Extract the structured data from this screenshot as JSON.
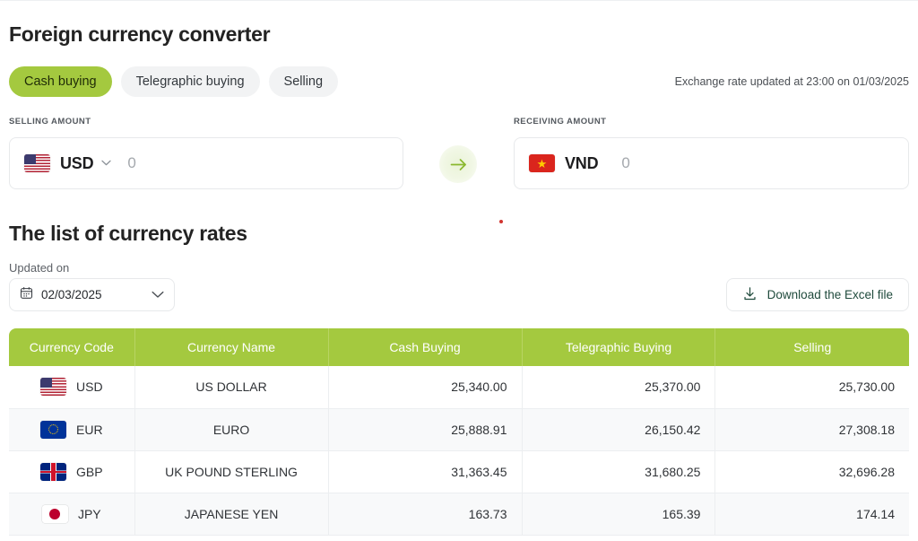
{
  "converter": {
    "title": "Foreign currency converter",
    "tabs": [
      {
        "label": "Cash buying",
        "active": true
      },
      {
        "label": "Telegraphic buying",
        "active": false
      },
      {
        "label": "Selling",
        "active": false
      }
    ],
    "rate_updated_text": "Exchange rate updated at 23:00 on 01/03/2025",
    "selling": {
      "label": "SELLING AMOUNT",
      "currency_code": "USD",
      "flag_icon": "us-flag-icon",
      "chevron_icon": "chevron-down-icon",
      "value": "0",
      "placeholder": "0"
    },
    "receiving": {
      "label": "RECEIVING AMOUNT",
      "currency_code": "VND",
      "flag_icon": "vn-flag-icon",
      "value": "0",
      "placeholder": "0"
    },
    "swap_icon": "arrow-right-icon"
  },
  "rates": {
    "title": "The list of currency rates",
    "updated_on_label": "Updated on",
    "date_value": "02/03/2025",
    "calendar_icon": "calendar-icon",
    "date_chevron_icon": "chevron-down-icon",
    "download_label": "Download the Excel file",
    "download_icon": "download-icon",
    "columns": [
      "Currency Code",
      "Currency Name",
      "Cash Buying",
      "Telegraphic Buying",
      "Selling"
    ],
    "rows": [
      {
        "code": "USD",
        "flag": "us-flag-icon",
        "name": "US DOLLAR",
        "cash": "25,340.00",
        "telegraphic": "25,370.00",
        "selling": "25,730.00"
      },
      {
        "code": "EUR",
        "flag": "eu-flag-icon",
        "name": "EURO",
        "cash": "25,888.91",
        "telegraphic": "26,150.42",
        "selling": "27,308.18"
      },
      {
        "code": "GBP",
        "flag": "gb-flag-icon",
        "name": "UK POUND STERLING",
        "cash": "31,363.45",
        "telegraphic": "31,680.25",
        "selling": "32,696.28"
      },
      {
        "code": "JPY",
        "flag": "jp-flag-icon",
        "name": "JAPANESE YEN",
        "cash": "163.73",
        "telegraphic": "165.39",
        "selling": "174.14"
      }
    ]
  },
  "colors": {
    "accent_green": "#a4c93f",
    "tab_inactive_bg": "#f2f3f4",
    "arrow_green": "#8ab82e",
    "download_text": "#1f4a3c",
    "marker_red": "#d1342f"
  }
}
